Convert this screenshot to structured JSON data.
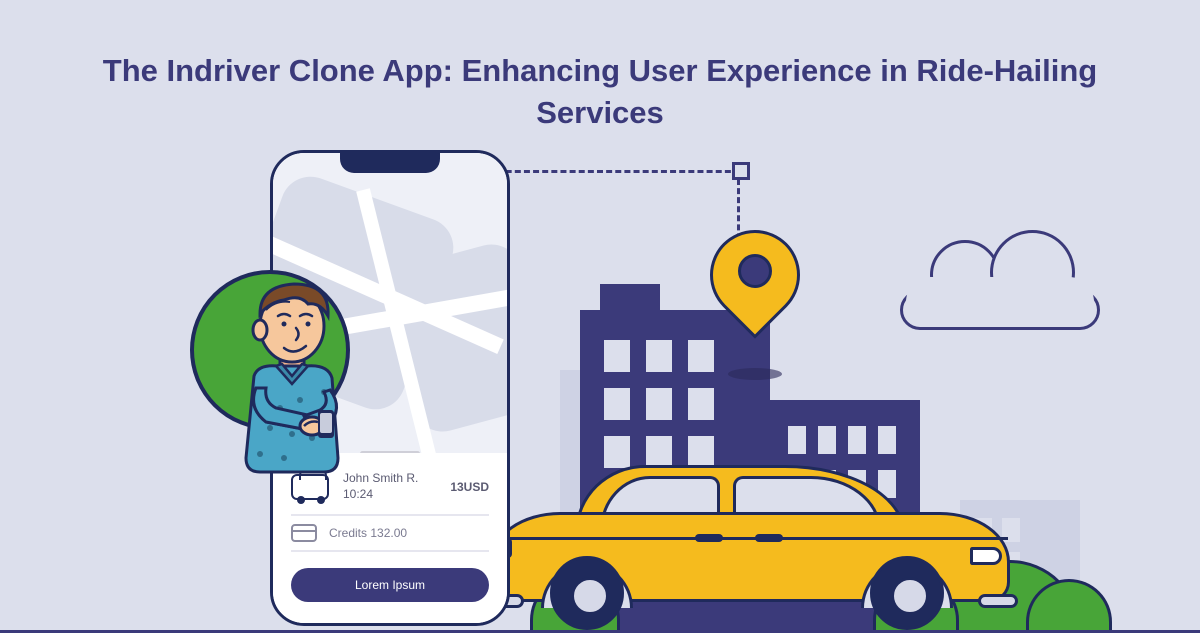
{
  "heading": "The Indriver Clone App: Enhancing User Experience in Ride-Hailing Services",
  "phone": {
    "driverName": "John Smith R.",
    "time": "10:24",
    "price": "13USD",
    "creditsLabel": "Credits 132.00",
    "cta": "Lorem Ipsum"
  },
  "icons": {
    "car": "car-icon",
    "card": "credit-card-icon",
    "pin": "map-pin-icon",
    "avatar": "user-avatar-icon"
  }
}
